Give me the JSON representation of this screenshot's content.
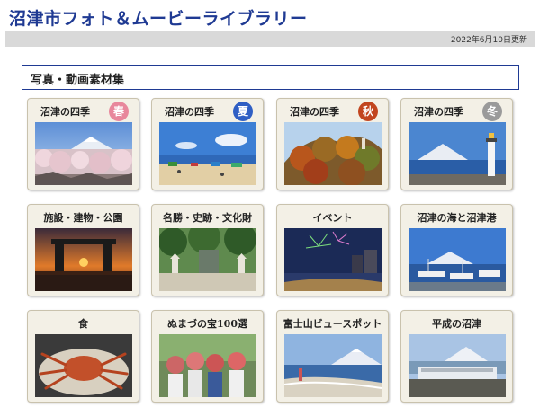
{
  "header": {
    "title": "沼津市フォト＆ムービーライブラリー",
    "updated": "2022年6月10日更新"
  },
  "section": {
    "title": "写真・動画素材集"
  },
  "cards": [
    {
      "label": "沼津の四季",
      "badge": "春",
      "badge_color": "#e8879c"
    },
    {
      "label": "沼津の四季",
      "badge": "夏",
      "badge_color": "#2f5fc4"
    },
    {
      "label": "沼津の四季",
      "badge": "秋",
      "badge_color": "#c2451f"
    },
    {
      "label": "沼津の四季",
      "badge": "冬",
      "badge_color": "#9a9a9a"
    },
    {
      "label": "施設・建物・公園"
    },
    {
      "label": "名勝・史跡・文化財"
    },
    {
      "label": "イベント"
    },
    {
      "label": "沼津の海と沼津港"
    },
    {
      "label": "食"
    },
    {
      "label": "ぬまづの宝100選"
    },
    {
      "label": "富士山ビュースポット"
    },
    {
      "label": "平成の沼津"
    }
  ]
}
